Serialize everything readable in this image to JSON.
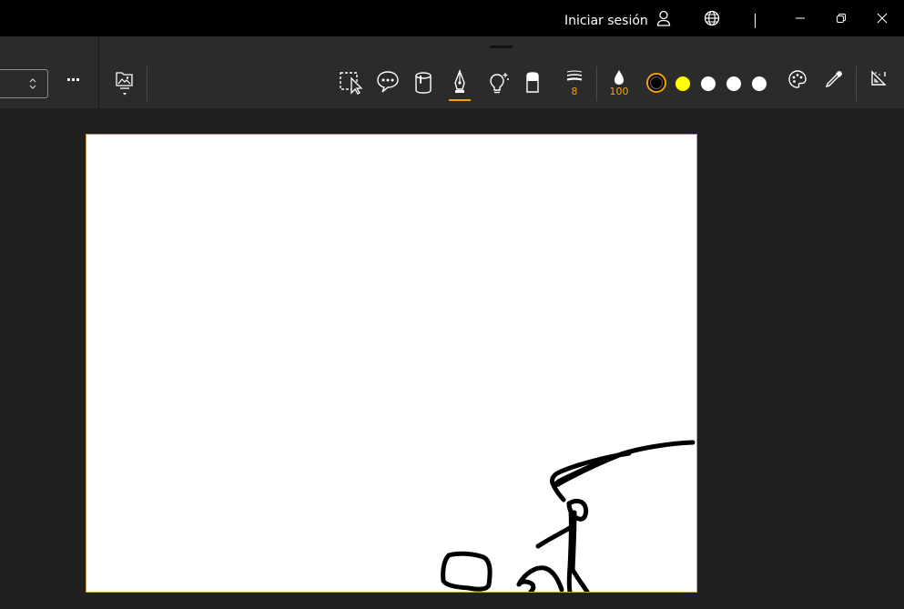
{
  "titlebar": {
    "signin_label": "Iniciar sesión",
    "icons": [
      "user-icon",
      "globe-icon",
      "minimize-icon",
      "restore-icon",
      "close-icon"
    ]
  },
  "toolbar": {
    "more_label": "···",
    "tools": [
      "lasso-select-icon",
      "comment-icon",
      "bucket-icon",
      "pen-icon",
      "lightbulb-icon",
      "eraser-icon"
    ],
    "active_tool": "pen",
    "stroke_size": "8",
    "opacity": "100",
    "colors": [
      "#000000",
      "#ffff00",
      "#ffffff",
      "#ffffff",
      "#ffffff"
    ],
    "selected_color_index": 0,
    "accent": "#f0a30a"
  },
  "canvas": {
    "background": "#ffffff",
    "border": "#c8a24a"
  }
}
